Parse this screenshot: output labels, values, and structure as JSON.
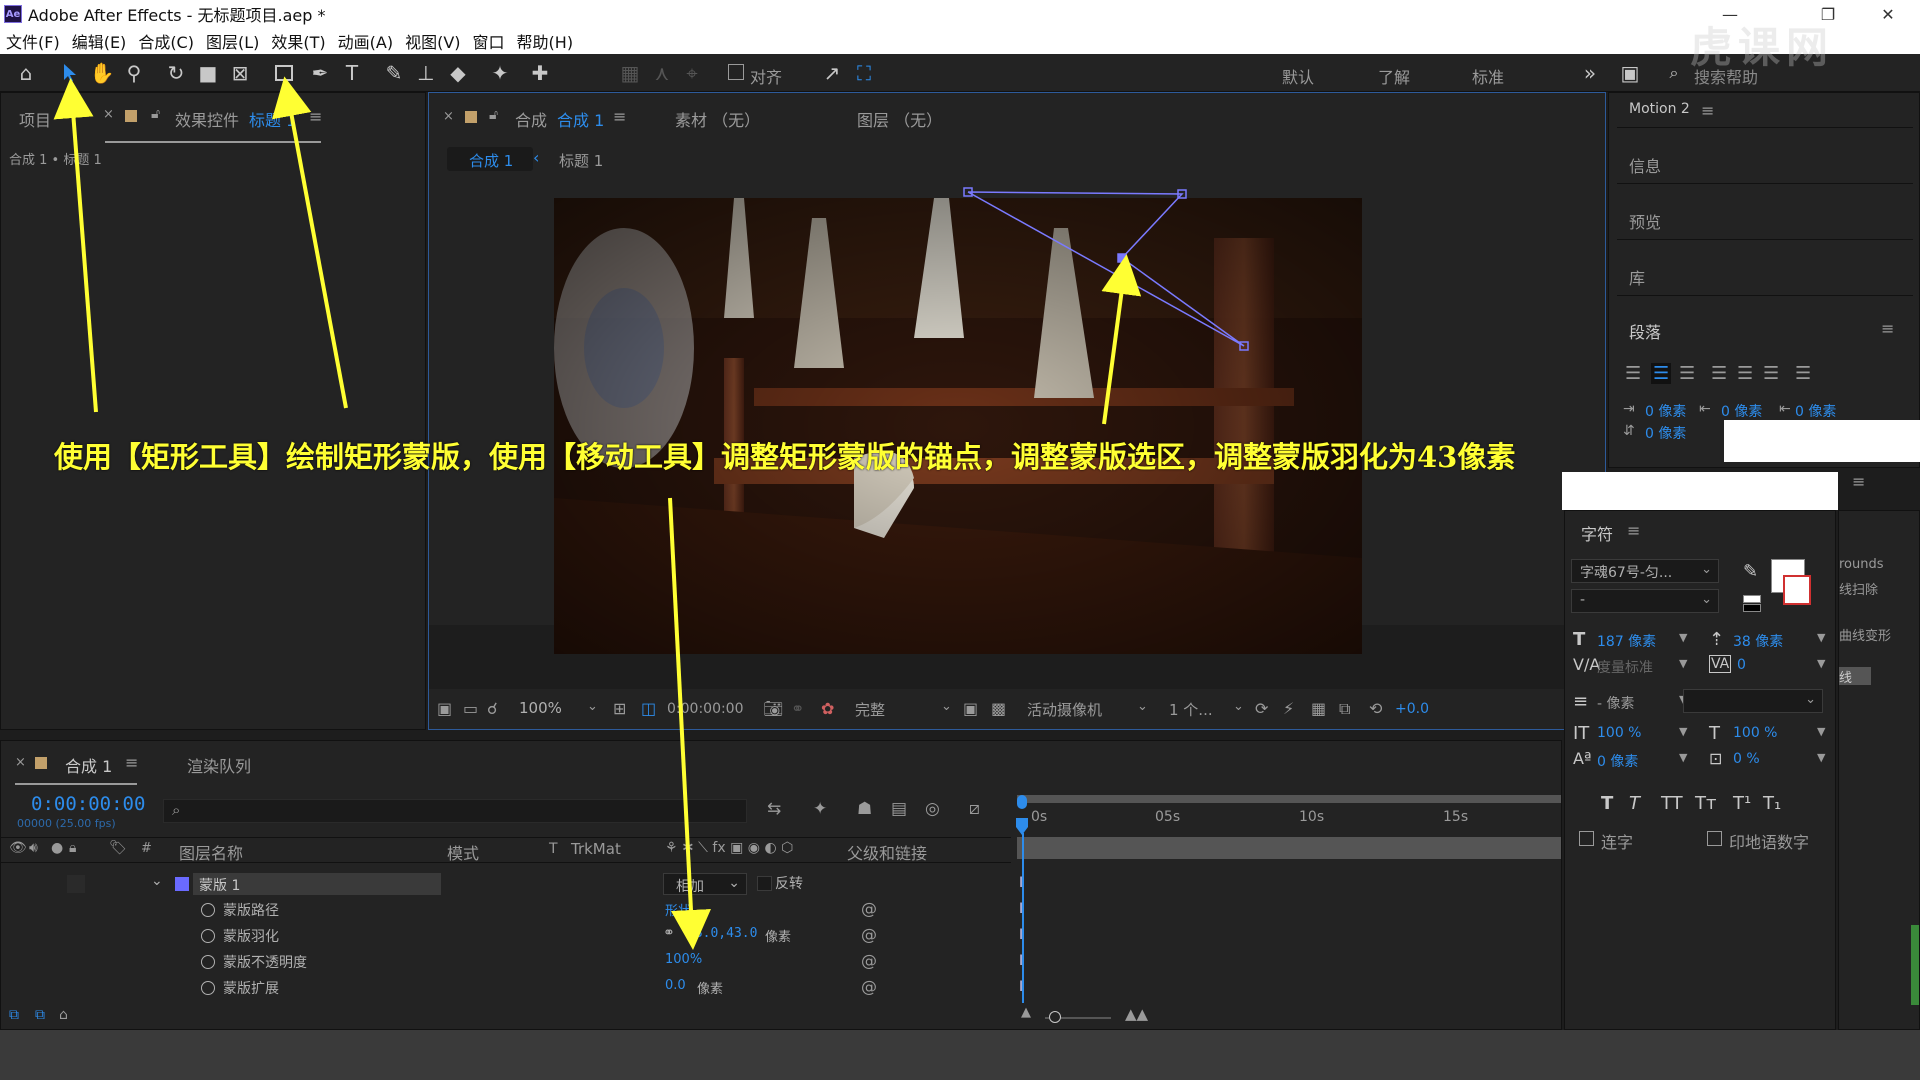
{
  "window": {
    "title": "Adobe After Effects - 无标题项目.aep *",
    "app_icon": "Ae"
  },
  "menu": [
    "文件(F)",
    "编辑(E)",
    "合成(C)",
    "图层(L)",
    "效果(T)",
    "动画(A)",
    "视图(V)",
    "窗口",
    "帮助(H)"
  ],
  "toolbar": {
    "align_label": "对齐",
    "workspaces": [
      "默认",
      "了解",
      "标准"
    ],
    "search_placeholder": "搜索帮助"
  },
  "project_panel": {
    "tab_project": "项目",
    "tab_effects_prefix": "效果控件",
    "tab_effects_target": "标题 1",
    "breadcrumb": "合成 1 • 标题 1"
  },
  "comp_panel": {
    "tab_prefix": "合成",
    "tab_name": "合成 1",
    "tab_footage": "素材 （无）",
    "tab_layer": "图层 （无）",
    "sub_tab_comp": "合成 1",
    "sub_tab_layer": "标题 1",
    "zoom": "100%",
    "timecode": "0:00:00:00",
    "resolution": "完整",
    "camera": "活动摄像机",
    "views": "1 个...",
    "exposure": "+0.0"
  },
  "timeline": {
    "tab_comp": "合成 1",
    "tab_render": "渲染队列",
    "timecode": "0:00:00:00",
    "frame_info": "00000 (25.00 fps)",
    "columns": {
      "name": "图层名称",
      "mode": "模式",
      "t": "T",
      "trkmat": "TrkMat",
      "parent": "父级和链接"
    },
    "ruler": [
      "0s",
      "05s",
      "10s",
      "15s"
    ],
    "mask": {
      "name": "蒙版 1",
      "mode": "相加",
      "invert": "反转",
      "props": [
        {
          "label": "蒙版路径",
          "value": "形状..."
        },
        {
          "label": "蒙版羽化",
          "value": "43.0,43.0",
          "unit": "像素"
        },
        {
          "label": "蒙版不透明度",
          "value": "100%"
        },
        {
          "label": "蒙版扩展",
          "value": "0.0",
          "unit": "像素"
        }
      ]
    }
  },
  "right_panel": {
    "top_tab": "Motion 2",
    "items": [
      "信息",
      "预览",
      "库"
    ],
    "paragraph": {
      "title": "段落",
      "indent_values": [
        "0 像素",
        "0 像素",
        "0 像素",
        "0 像素"
      ]
    },
    "character": {
      "title": "字符",
      "font": "字魂67号-匀...",
      "style": "-",
      "size": "187 像素",
      "leading": "38 像素",
      "kerning": "度量标准",
      "tracking": "0",
      "stroke_width": "- 像素",
      "vscale": "100 %",
      "hscale": "100 %",
      "baseline": "0 像素",
      "tsume": "0 %",
      "styles": [
        "T",
        "T",
        "TT",
        "Tт",
        "T¹",
        "T₁"
      ],
      "ligatures": "连字",
      "hindi_digits": "印地语数字"
    },
    "partial_labels": [
      "rounds",
      "线扫除",
      "曲线变形",
      "线"
    ]
  },
  "annotation": "使用【矩形工具】绘制矩形蒙版，使用【移动工具】调整矩形蒙版的锚点，调整蒙版选区，调整蒙版羽化为43像素",
  "watermark": "虎课网",
  "colors": {
    "accent": "#2d8ceb",
    "annotation": "#ffff33",
    "mask_path": "#7a7aff"
  }
}
